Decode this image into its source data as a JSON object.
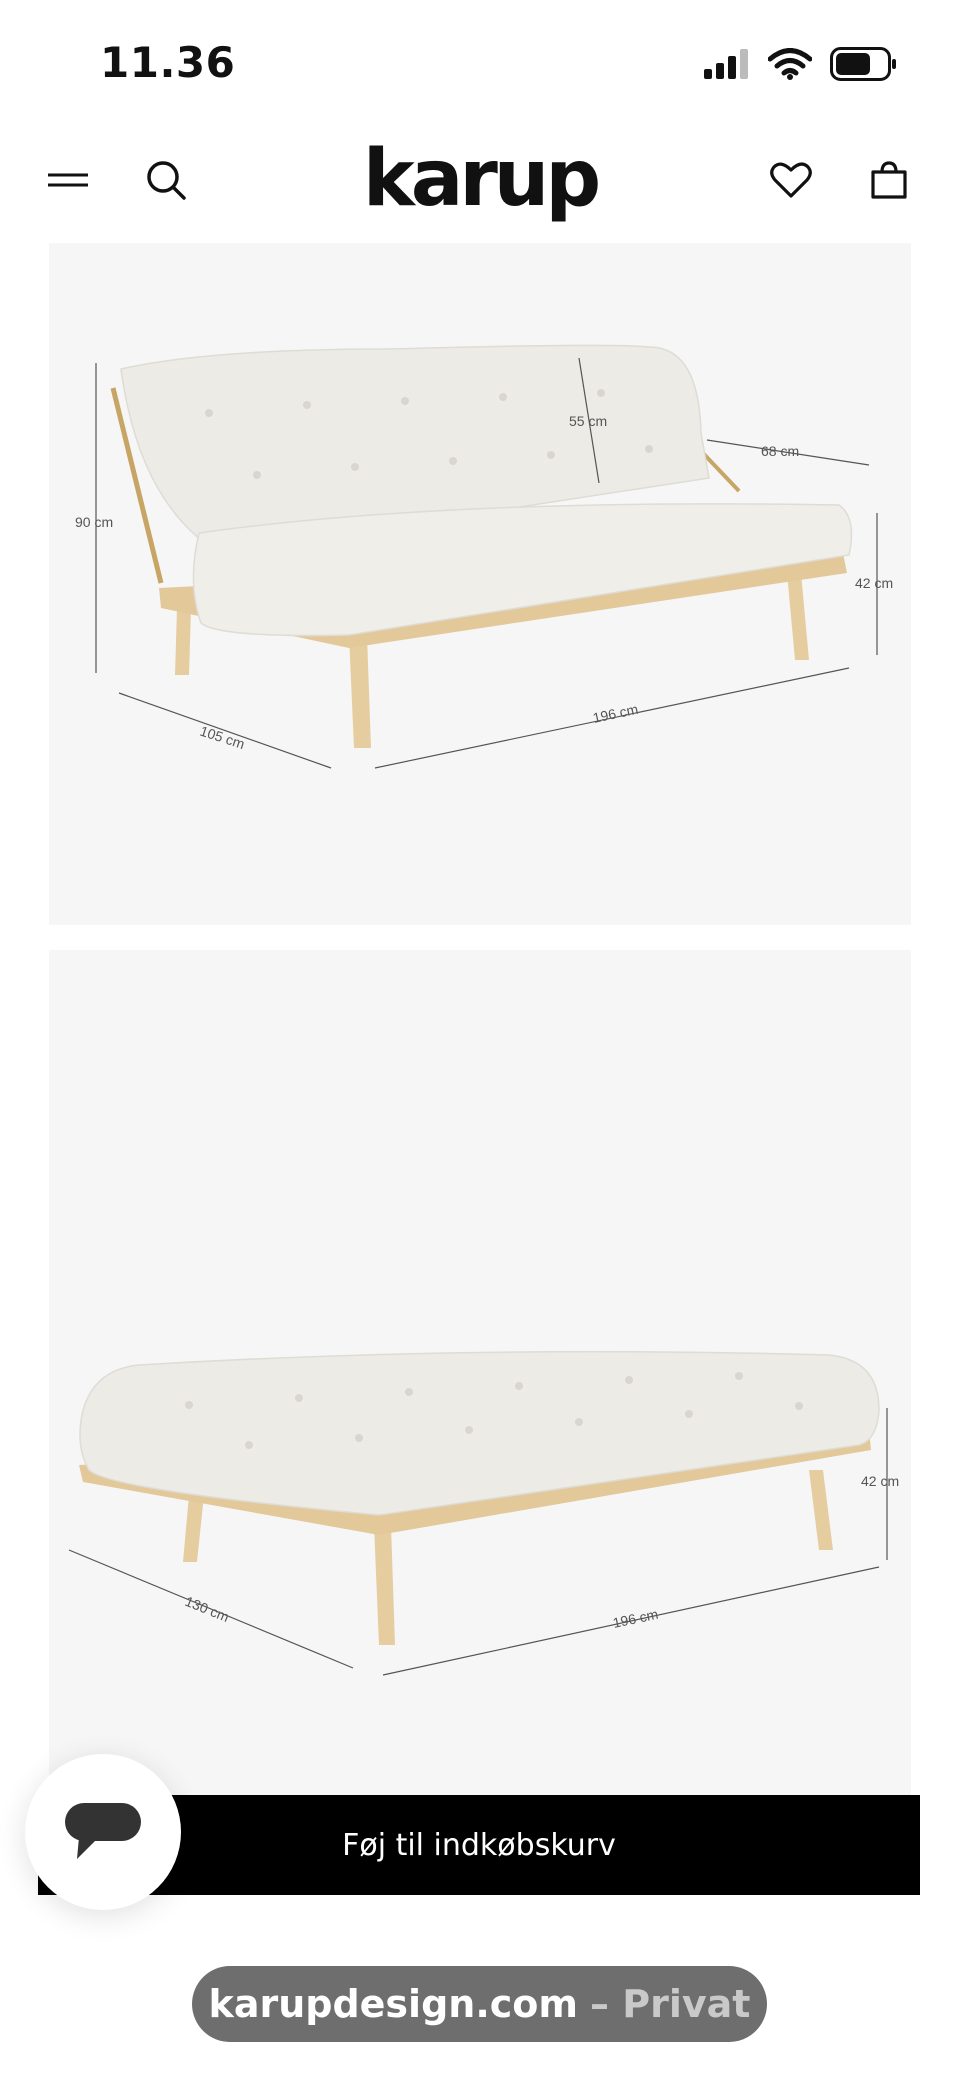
{
  "status_bar": {
    "time": "11.36"
  },
  "header": {
    "brand": "karup"
  },
  "images": {
    "sofa_upright": {
      "dimensions": {
        "height": "90 cm",
        "back_height": "55 cm",
        "arm": "68 cm",
        "seat_height": "42 cm",
        "depth": "105 cm",
        "width": "196 cm"
      }
    },
    "sofa_bed": {
      "dimensions": {
        "seat_height": "42 cm",
        "depth": "130 cm",
        "width": "196 cm"
      }
    }
  },
  "cart": {
    "label": "Føj til indkøbskurv"
  },
  "browser": {
    "domain": "karupdesign.com",
    "mode": "– Privat"
  },
  "colors": {
    "accent": "#000000",
    "image_bg": "#f6f6f6",
    "cushion": "#ecebe6",
    "wood": "#e3c99a"
  },
  "icons": [
    "signal-icon",
    "wifi-icon",
    "battery-icon",
    "menu-icon",
    "search-icon",
    "heart-icon",
    "bag-icon",
    "chat-icon"
  ]
}
